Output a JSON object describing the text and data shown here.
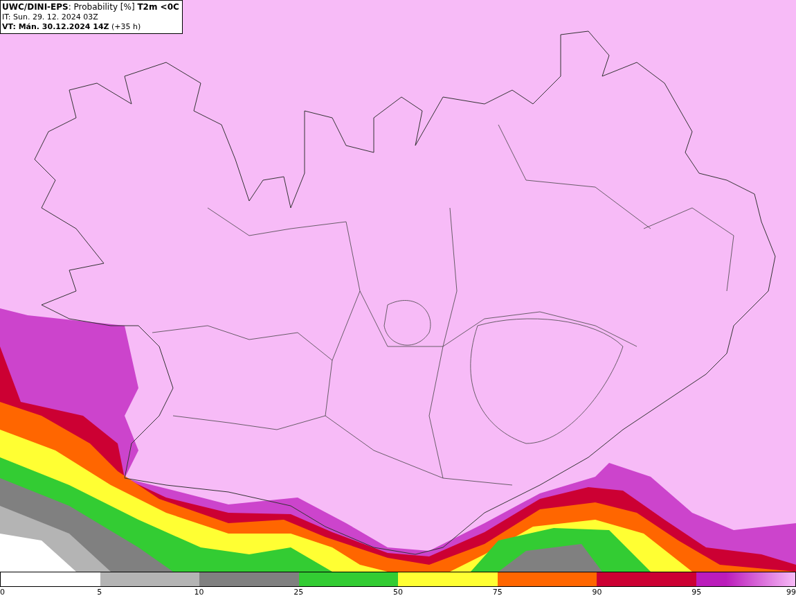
{
  "header": {
    "title": "**UWC/DINI-EPS**: Probability [%] **T2m <0C**",
    "init_time": "IT: Sun. 29. 12. 2024 03Z",
    "valid_time": "**VT: Mán. 30.12.2024 14Z** (+35 h)"
  },
  "legend": {
    "segments": [
      {
        "color": "#ffffff",
        "fade": false
      },
      {
        "color": "#b4b4b4",
        "fade": false
      },
      {
        "color": "#808080",
        "fade": false
      },
      {
        "color": "#33cc33",
        "fade": false
      },
      {
        "color": "#ffff33",
        "fade": false
      },
      {
        "color": "#ff6600",
        "fade": false
      },
      {
        "color": "#cc0033",
        "fade": false
      },
      {
        "color": "#bb1cbb",
        "fade": true
      }
    ],
    "ticks": [
      "0",
      "5",
      "10",
      "25",
      "50",
      "75",
      "90",
      "95",
      "99"
    ]
  }
}
